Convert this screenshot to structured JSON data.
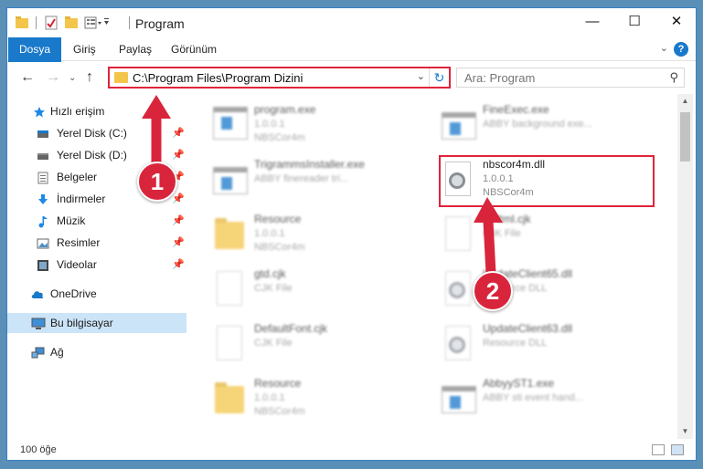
{
  "window": {
    "title": "Program",
    "minimize_icon": "minimize-icon",
    "maximize_icon": "maximize-icon",
    "close_icon": "close-icon",
    "accent_color": "#1979ca"
  },
  "ribbon": {
    "tabs": [
      "Dosya",
      "Giriş",
      "Paylaş",
      "Görünüm"
    ],
    "help_label": "?"
  },
  "nav": {
    "address_path": "C:\\Program Files\\Program Dizini",
    "search_placeholder": "Ara: Program"
  },
  "sidebar": {
    "items": [
      {
        "label": "Hızlı erişim",
        "icon": "star-icon",
        "pinned": false
      },
      {
        "label": "Yerel Disk (C:)",
        "icon": "drive-icon",
        "pinned": true
      },
      {
        "label": "Yerel Disk (D:)",
        "icon": "drive-icon",
        "pinned": true
      },
      {
        "label": "Belgeler",
        "icon": "documents-icon",
        "pinned": true
      },
      {
        "label": "İndirmeler",
        "icon": "download-icon",
        "pinned": true
      },
      {
        "label": "Müzik",
        "icon": "music-icon",
        "pinned": true
      },
      {
        "label": "Resimler",
        "icon": "pictures-icon",
        "pinned": true
      },
      {
        "label": "Videolar",
        "icon": "video-icon",
        "pinned": true
      },
      {
        "label": "OneDrive",
        "icon": "cloud-icon",
        "pinned": false
      },
      {
        "label": "Bu bilgisayar",
        "icon": "computer-icon",
        "pinned": false,
        "selected": true
      },
      {
        "label": "Ağ",
        "icon": "network-icon",
        "pinned": false
      }
    ]
  },
  "files": {
    "left": [
      {
        "name": "program.exe",
        "line2": "1.0.0.1",
        "line3": "NBSCor4m",
        "icon": "exe-icon"
      },
      {
        "name": "TrigrammsInstaller.exe",
        "line2": "ABBY finereader tri...",
        "line3": "",
        "icon": "app-icon"
      },
      {
        "name": "Resource",
        "line2": "1.0.0.1",
        "line3": "NBSCor4m",
        "icon": "folder-icon"
      },
      {
        "name": "gtd.cjk",
        "line2": "CJK File",
        "line3": "",
        "icon": "document-icon"
      },
      {
        "name": "DefaultFont.cjk",
        "line2": "CJK File",
        "line3": "",
        "icon": "document-icon"
      },
      {
        "name": "Resource",
        "line2": "1.0.0.1",
        "line3": "NBSCor4m",
        "icon": "folder-icon"
      }
    ],
    "right": [
      {
        "name": "FineExec.exe",
        "line2": "ABBY background exe...",
        "line3": "",
        "icon": "app-icon"
      },
      {
        "name": "nbscor4m.dll",
        "line2": "1.0.0.1",
        "line3": "NBSCor4m",
        "icon": "dll-gear-icon"
      },
      {
        "name": "...Html.cjk",
        "line2": "CJK File",
        "line3": "",
        "icon": "document-icon"
      },
      {
        "name": "UpdateClient65.dll",
        "line2": "Resource DLL",
        "line3": "",
        "icon": "dll-gear-icon"
      },
      {
        "name": "UpdateClient63.dll",
        "line2": "Resource DLL",
        "line3": "",
        "icon": "dll-gear-icon"
      },
      {
        "name": "AbbyyST1.exe",
        "line2": "ABBY sti event hand...",
        "line3": "",
        "icon": "app-icon"
      }
    ]
  },
  "status": {
    "item_count": "100 öğe"
  },
  "callouts": [
    "1",
    "2"
  ],
  "highlight_color": "#e0243a"
}
